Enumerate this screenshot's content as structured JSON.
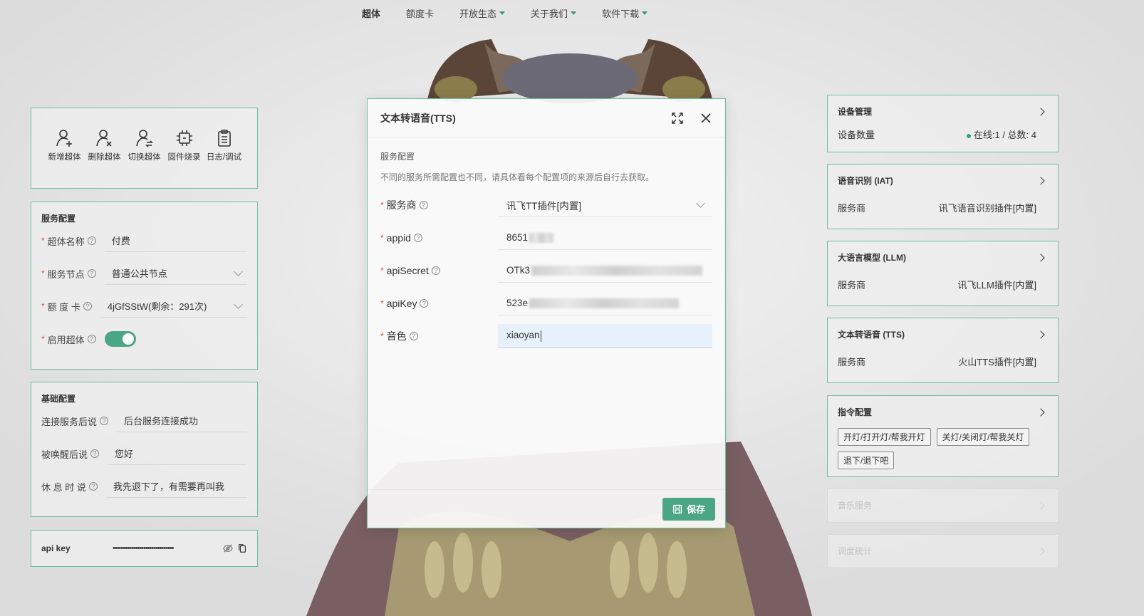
{
  "nav": {
    "items": [
      {
        "label": "超体",
        "active": true,
        "dropdown": false
      },
      {
        "label": "额度卡",
        "active": false,
        "dropdown": false
      },
      {
        "label": "开放生态",
        "active": false,
        "dropdown": true
      },
      {
        "label": "关于我们",
        "active": false,
        "dropdown": true
      },
      {
        "label": "软件下载",
        "active": false,
        "dropdown": true
      }
    ]
  },
  "actions": [
    {
      "label": "新增超体",
      "icon": "user-plus-icon"
    },
    {
      "label": "删除超体",
      "icon": "user-remove-icon"
    },
    {
      "label": "切换超体",
      "icon": "user-switch-icon"
    },
    {
      "label": "固件烧录",
      "icon": "chip-icon"
    },
    {
      "label": "日志/调试",
      "icon": "clipboard-icon"
    }
  ],
  "service_config": {
    "title": "服务配置",
    "name_label": "超体名称",
    "name_value": "付费",
    "node_label": "服务节点",
    "node_value": "普通公共节点",
    "card_label": "额 度 卡",
    "card_value": "4jGfSStW(剩余：291次)",
    "enable_label": "启用超体",
    "enabled": true
  },
  "basic_config": {
    "title": "基础配置",
    "rows": [
      {
        "label": "连接服务后说",
        "value": "后台服务连接成功"
      },
      {
        "label": "被唤醒后说",
        "value": "您好"
      },
      {
        "label": "休 息 时 说",
        "value": "我先退下了，有需要再叫我"
      }
    ]
  },
  "apikey": {
    "label": "api key",
    "masked": "••••••••••••••••••••••••••••••"
  },
  "cards": {
    "device": {
      "title": "设备管理",
      "row_label": "设备数量",
      "row_value": "在线:1 / 总数: 4"
    },
    "iat": {
      "title": "语音识别 (IAT)",
      "row_label": "服务商",
      "row_value": "讯飞语音识别插件[内置]"
    },
    "llm": {
      "title": "大语言模型 (LLM)",
      "row_label": "服务商",
      "row_value": "讯飞LLM插件[内置]"
    },
    "tts": {
      "title": "文本转语音 (TTS)",
      "row_label": "服务商",
      "row_value": "火山TTS插件[内置]"
    },
    "command": {
      "title": "指令配置",
      "tags": [
        "开灯/打开灯/帮我开灯",
        "关灯/关闭灯/帮我关灯",
        "退下/退下吧"
      ]
    },
    "music": {
      "title": "音乐服务"
    },
    "stats": {
      "title": "调度统计"
    }
  },
  "modal": {
    "title": "文本转语音(TTS)",
    "section_title": "服务配置",
    "section_desc": "不同的服务所需配置也不同，请具体看每个配置项的来源后自行去获取。",
    "fields": {
      "provider_label": "服务商",
      "provider_value": "讯飞TT插件[内置]",
      "appid_label": "appid",
      "appid_value": "8651",
      "secret_label": "apiSecret",
      "secret_value": "OTk3",
      "key_label": "apiKey",
      "key_value": "523e",
      "voice_label": "音色",
      "voice_value": "xiaoyan"
    },
    "save_label": "保存"
  },
  "colors": {
    "accent": "#4aa684",
    "border": "#6fbf9f",
    "required": "#e04b3a"
  }
}
